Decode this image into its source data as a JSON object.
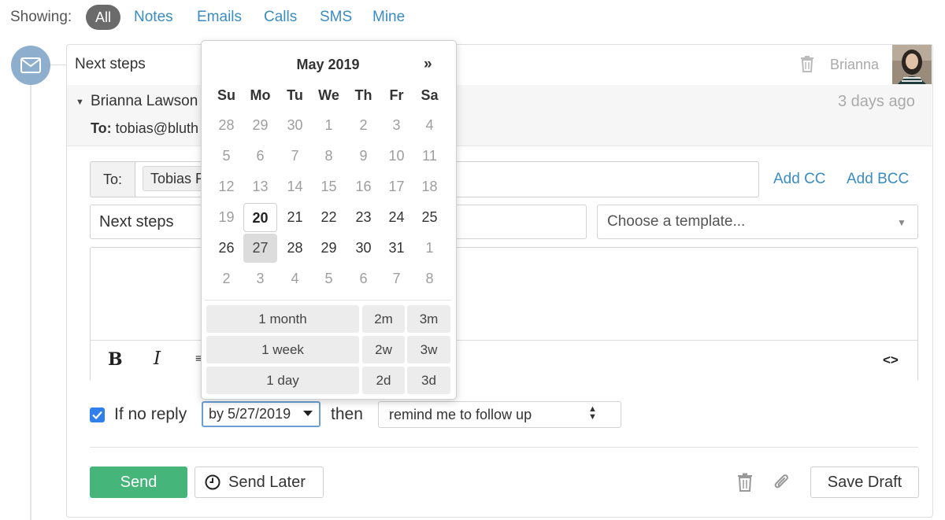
{
  "filter": {
    "label": "Showing:",
    "active": "All",
    "options": [
      "Notes",
      "Emails",
      "Calls",
      "SMS",
      "Mine"
    ]
  },
  "activity": {
    "subject": "Next steps",
    "author": "Brianna",
    "from_name": "Brianna Lawson",
    "time_ago": "3 days ago",
    "to_label": "To:",
    "to_address": "tobias@bluth"
  },
  "compose": {
    "to_label": "To:",
    "to_token": "Tobias F",
    "add_cc": "Add CC",
    "add_bcc": "Add BCC",
    "subject_value": "Next steps",
    "template_placeholder": "Choose a template...",
    "toolbar": {
      "bold": "B",
      "italic": "I",
      "code": "<>"
    }
  },
  "followup": {
    "checked": true,
    "if_no_reply": "If no reply",
    "date_value": "by 5/27/2019",
    "then": "then",
    "action": "remind me to follow up"
  },
  "actions": {
    "send": "Send",
    "send_later": "Send Later",
    "save_draft": "Save Draft"
  },
  "datepicker": {
    "title": "May 2019",
    "next": "»",
    "weekdays": [
      "Su",
      "Mo",
      "Tu",
      "We",
      "Th",
      "Fr",
      "Sa"
    ],
    "weeks": [
      [
        "28",
        "29",
        "30",
        "1",
        "2",
        "3",
        "4"
      ],
      [
        "5",
        "6",
        "7",
        "8",
        "9",
        "10",
        "11"
      ],
      [
        "12",
        "13",
        "14",
        "15",
        "16",
        "17",
        "18"
      ],
      [
        "19",
        "20",
        "21",
        "22",
        "23",
        "24",
        "25"
      ],
      [
        "26",
        "27",
        "28",
        "29",
        "30",
        "31",
        "1"
      ],
      [
        "2",
        "3",
        "4",
        "5",
        "6",
        "7",
        "8"
      ]
    ],
    "today": "20",
    "selected": "27",
    "quick": [
      [
        "1 month",
        "2m",
        "3m"
      ],
      [
        "1 week",
        "2w",
        "3w"
      ],
      [
        "1 day",
        "2d",
        "3d"
      ]
    ]
  },
  "colors": {
    "link": "#3a8cc1",
    "send": "#45b57a",
    "checkbox": "#2f80ed",
    "pill": "#6b6b6b"
  }
}
